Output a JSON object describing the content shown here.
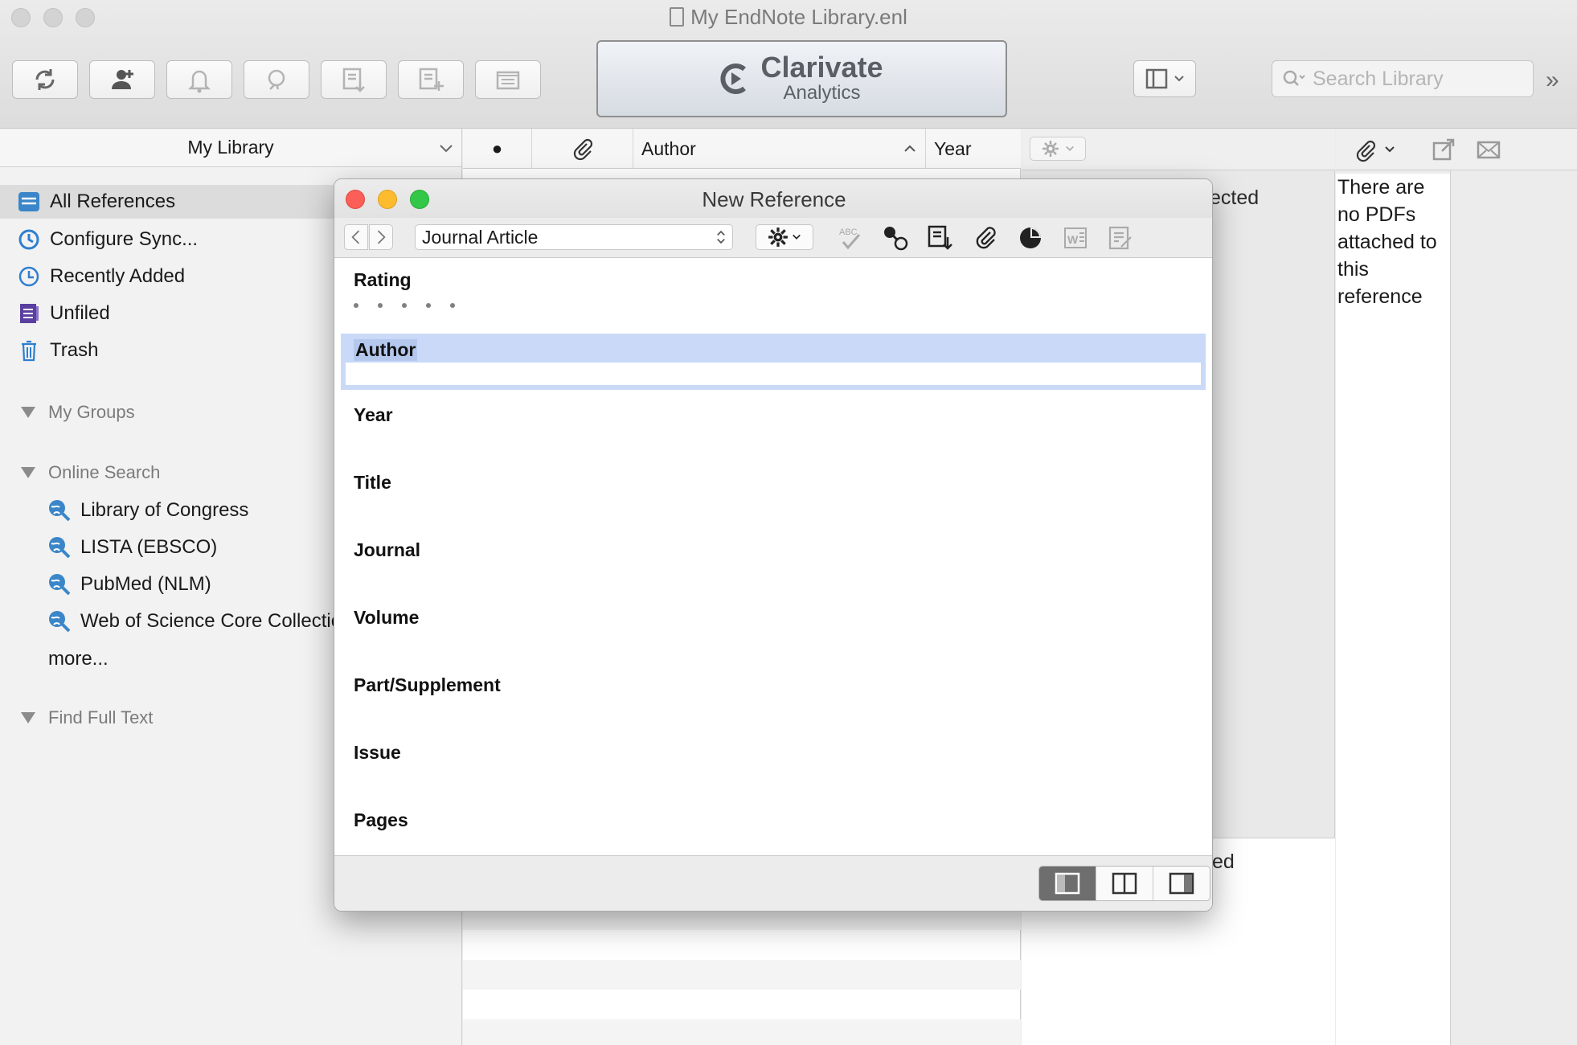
{
  "window": {
    "title": "My EndNote Library.enl",
    "traffic_colors": [
      "#d3d3d3",
      "#d3d3d3",
      "#d3d3d3"
    ]
  },
  "toolbar": {
    "buttons": [
      {
        "name": "sync",
        "icon": "sync-icon"
      },
      {
        "name": "add-user",
        "icon": "add-user-icon"
      },
      {
        "name": "notifications",
        "icon": "bell-icon"
      },
      {
        "name": "find-pdf",
        "icon": "find-pdf-icon"
      },
      {
        "name": "import",
        "icon": "import-icon"
      },
      {
        "name": "new-reference",
        "icon": "new-reference-icon"
      },
      {
        "name": "open-folder",
        "icon": "folder-icon"
      }
    ],
    "brand_name": "Clarivate",
    "brand_sub": "Analytics",
    "layout_icon": "panel-layout-icon",
    "search_placeholder": "Search Library",
    "overflow": "»"
  },
  "sidebar": {
    "library_label": "My Library",
    "items": [
      {
        "label": "All References",
        "icon": "all-references-icon",
        "selected": true
      },
      {
        "label": "Configure Sync...",
        "icon": "sync-icon",
        "selected": false
      },
      {
        "label": "Recently Added",
        "icon": "clock-icon",
        "selected": false
      },
      {
        "label": "Unfiled",
        "icon": "unfiled-icon",
        "selected": false
      },
      {
        "label": "Trash",
        "icon": "trash-icon",
        "selected": false
      }
    ],
    "sections": {
      "my_groups": "My Groups",
      "online_search": "Online Search",
      "find_full_text": "Find Full Text"
    },
    "online_items": [
      {
        "label": "Library of Congress",
        "icon": "globe-search-icon"
      },
      {
        "label": "LISTA (EBSCO)",
        "icon": "globe-search-icon"
      },
      {
        "label": "PubMed (NLM)",
        "icon": "globe-search-icon"
      },
      {
        "label": "Web of Science Core Collectic",
        "icon": "globe-search-icon"
      }
    ],
    "more_label": "more..."
  },
  "reference_list": {
    "columns": {
      "read": "●",
      "attachment": "paperclip-icon",
      "author": "Author",
      "year": "Year"
    },
    "sort_indicator": "^"
  },
  "preview": {
    "no_selection_top": "ected",
    "no_selection_bottom": "ted"
  },
  "pdf_pane": {
    "message_lines": [
      "There are",
      "no PDFs",
      "attached to",
      "this",
      "reference"
    ]
  },
  "dialog": {
    "title": "New Reference",
    "dot_colors": {
      "close": "#fc5f57",
      "minimize": "#fdbc2e",
      "zoom": "#33c748"
    },
    "reference_type": "Journal Article",
    "fields": {
      "rating": "Rating",
      "author": "Author",
      "year": "Year",
      "title": "Title",
      "journal": "Journal",
      "volume": "Volume",
      "part_supplement": "Part/Supplement",
      "issue": "Issue",
      "pages": "Pages"
    },
    "author_value": "",
    "rating_stars": 0,
    "tools": [
      "spellcheck-icon",
      "link-icon",
      "import-icon",
      "paperclip-icon",
      "pie-chart-icon",
      "word-icon",
      "edit-notes-icon"
    ],
    "layout_modes": [
      "layout-left-icon",
      "layout-split-icon",
      "layout-right-icon"
    ],
    "selected_layout": 0,
    "highlight_color": "#c9d9f7"
  }
}
